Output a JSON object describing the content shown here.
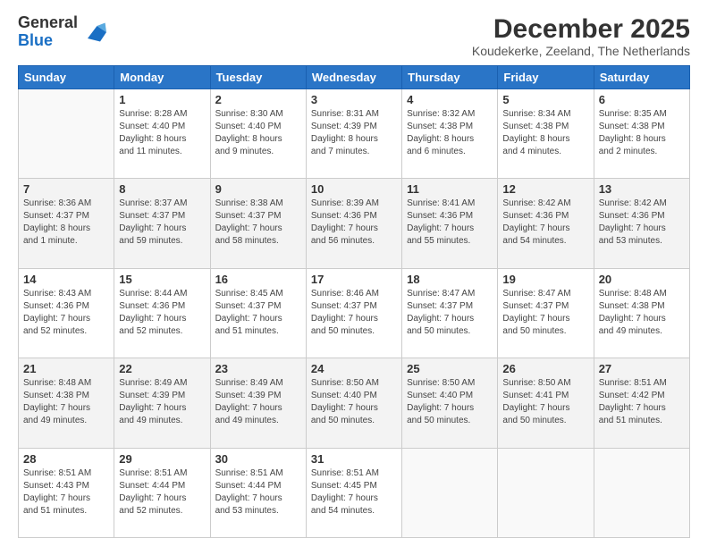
{
  "logo": {
    "line1": "General",
    "line2": "Blue"
  },
  "title": "December 2025",
  "subtitle": "Koudekerke, Zeeland, The Netherlands",
  "weekdays": [
    "Sunday",
    "Monday",
    "Tuesday",
    "Wednesday",
    "Thursday",
    "Friday",
    "Saturday"
  ],
  "weeks": [
    [
      {
        "day": "",
        "info": ""
      },
      {
        "day": "1",
        "info": "Sunrise: 8:28 AM\nSunset: 4:40 PM\nDaylight: 8 hours\nand 11 minutes."
      },
      {
        "day": "2",
        "info": "Sunrise: 8:30 AM\nSunset: 4:40 PM\nDaylight: 8 hours\nand 9 minutes."
      },
      {
        "day": "3",
        "info": "Sunrise: 8:31 AM\nSunset: 4:39 PM\nDaylight: 8 hours\nand 7 minutes."
      },
      {
        "day": "4",
        "info": "Sunrise: 8:32 AM\nSunset: 4:38 PM\nDaylight: 8 hours\nand 6 minutes."
      },
      {
        "day": "5",
        "info": "Sunrise: 8:34 AM\nSunset: 4:38 PM\nDaylight: 8 hours\nand 4 minutes."
      },
      {
        "day": "6",
        "info": "Sunrise: 8:35 AM\nSunset: 4:38 PM\nDaylight: 8 hours\nand 2 minutes."
      }
    ],
    [
      {
        "day": "7",
        "info": "Sunrise: 8:36 AM\nSunset: 4:37 PM\nDaylight: 8 hours\nand 1 minute."
      },
      {
        "day": "8",
        "info": "Sunrise: 8:37 AM\nSunset: 4:37 PM\nDaylight: 7 hours\nand 59 minutes."
      },
      {
        "day": "9",
        "info": "Sunrise: 8:38 AM\nSunset: 4:37 PM\nDaylight: 7 hours\nand 58 minutes."
      },
      {
        "day": "10",
        "info": "Sunrise: 8:39 AM\nSunset: 4:36 PM\nDaylight: 7 hours\nand 56 minutes."
      },
      {
        "day": "11",
        "info": "Sunrise: 8:41 AM\nSunset: 4:36 PM\nDaylight: 7 hours\nand 55 minutes."
      },
      {
        "day": "12",
        "info": "Sunrise: 8:42 AM\nSunset: 4:36 PM\nDaylight: 7 hours\nand 54 minutes."
      },
      {
        "day": "13",
        "info": "Sunrise: 8:42 AM\nSunset: 4:36 PM\nDaylight: 7 hours\nand 53 minutes."
      }
    ],
    [
      {
        "day": "14",
        "info": "Sunrise: 8:43 AM\nSunset: 4:36 PM\nDaylight: 7 hours\nand 52 minutes."
      },
      {
        "day": "15",
        "info": "Sunrise: 8:44 AM\nSunset: 4:36 PM\nDaylight: 7 hours\nand 52 minutes."
      },
      {
        "day": "16",
        "info": "Sunrise: 8:45 AM\nSunset: 4:37 PM\nDaylight: 7 hours\nand 51 minutes."
      },
      {
        "day": "17",
        "info": "Sunrise: 8:46 AM\nSunset: 4:37 PM\nDaylight: 7 hours\nand 50 minutes."
      },
      {
        "day": "18",
        "info": "Sunrise: 8:47 AM\nSunset: 4:37 PM\nDaylight: 7 hours\nand 50 minutes."
      },
      {
        "day": "19",
        "info": "Sunrise: 8:47 AM\nSunset: 4:37 PM\nDaylight: 7 hours\nand 50 minutes."
      },
      {
        "day": "20",
        "info": "Sunrise: 8:48 AM\nSunset: 4:38 PM\nDaylight: 7 hours\nand 49 minutes."
      }
    ],
    [
      {
        "day": "21",
        "info": "Sunrise: 8:48 AM\nSunset: 4:38 PM\nDaylight: 7 hours\nand 49 minutes."
      },
      {
        "day": "22",
        "info": "Sunrise: 8:49 AM\nSunset: 4:39 PM\nDaylight: 7 hours\nand 49 minutes."
      },
      {
        "day": "23",
        "info": "Sunrise: 8:49 AM\nSunset: 4:39 PM\nDaylight: 7 hours\nand 49 minutes."
      },
      {
        "day": "24",
        "info": "Sunrise: 8:50 AM\nSunset: 4:40 PM\nDaylight: 7 hours\nand 50 minutes."
      },
      {
        "day": "25",
        "info": "Sunrise: 8:50 AM\nSunset: 4:40 PM\nDaylight: 7 hours\nand 50 minutes."
      },
      {
        "day": "26",
        "info": "Sunrise: 8:50 AM\nSunset: 4:41 PM\nDaylight: 7 hours\nand 50 minutes."
      },
      {
        "day": "27",
        "info": "Sunrise: 8:51 AM\nSunset: 4:42 PM\nDaylight: 7 hours\nand 51 minutes."
      }
    ],
    [
      {
        "day": "28",
        "info": "Sunrise: 8:51 AM\nSunset: 4:43 PM\nDaylight: 7 hours\nand 51 minutes."
      },
      {
        "day": "29",
        "info": "Sunrise: 8:51 AM\nSunset: 4:44 PM\nDaylight: 7 hours\nand 52 minutes."
      },
      {
        "day": "30",
        "info": "Sunrise: 8:51 AM\nSunset: 4:44 PM\nDaylight: 7 hours\nand 53 minutes."
      },
      {
        "day": "31",
        "info": "Sunrise: 8:51 AM\nSunset: 4:45 PM\nDaylight: 7 hours\nand 54 minutes."
      },
      {
        "day": "",
        "info": ""
      },
      {
        "day": "",
        "info": ""
      },
      {
        "day": "",
        "info": ""
      }
    ]
  ]
}
